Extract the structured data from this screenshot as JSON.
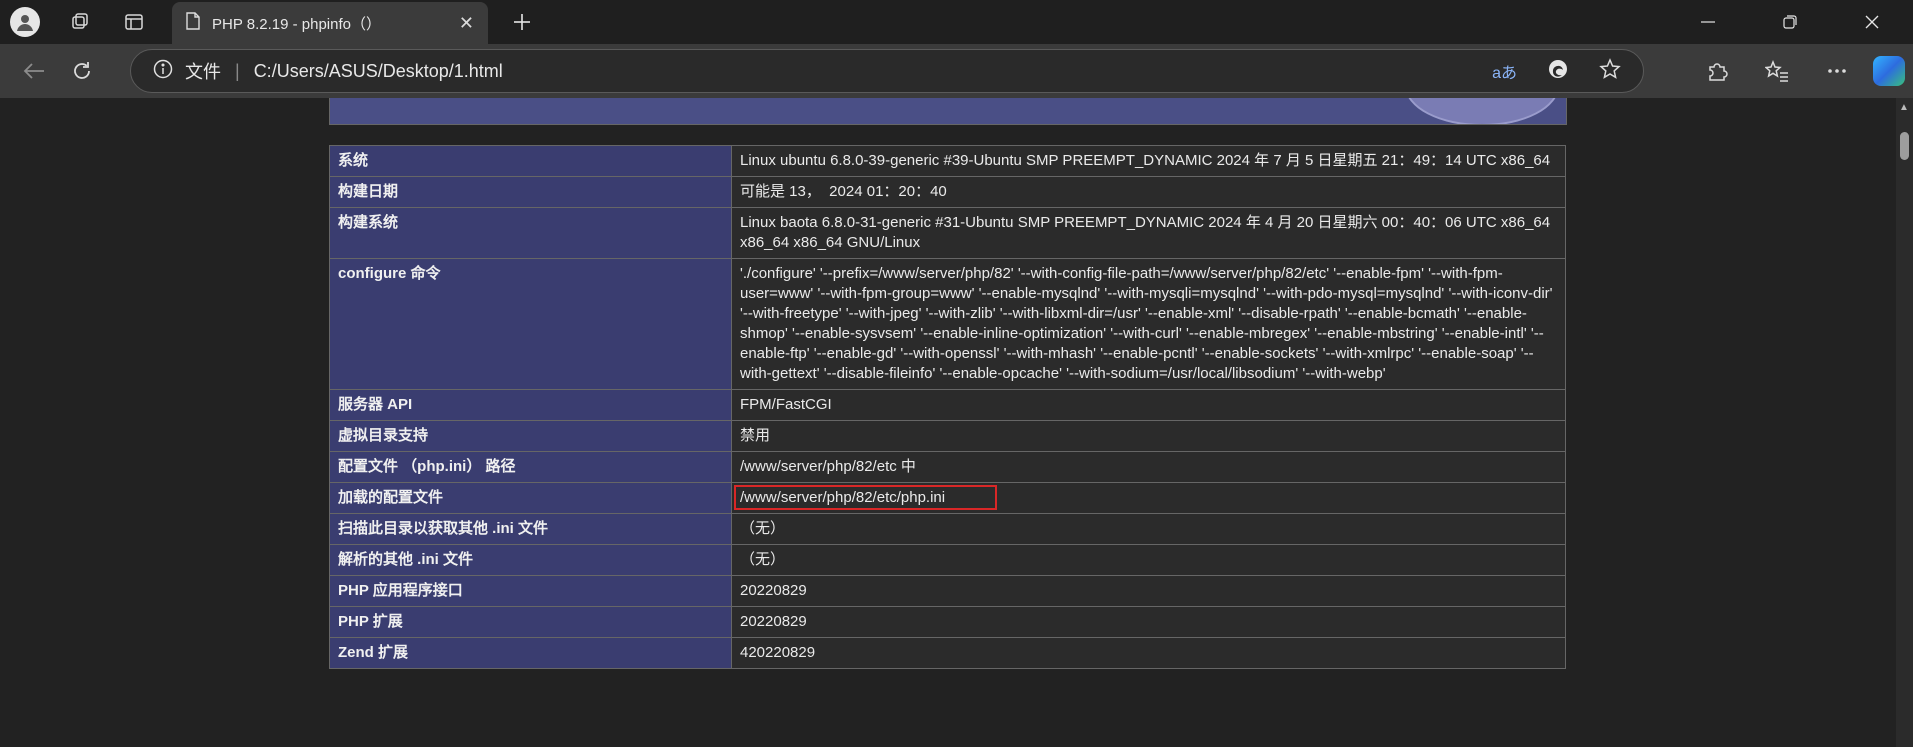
{
  "browser": {
    "tab": {
      "title": "PHP 8.2.19 - phpinfo（）"
    },
    "address_bar": {
      "site_label": "文件",
      "url": "C:/Users/ASUS/Desktop/1.html"
    },
    "icons": {
      "profile": "person-icon",
      "workspaces": "workspaces-icon",
      "vertical_tabs": "vertical-tabs-icon",
      "new_tab": "plus-icon",
      "back": "back-arrow-icon",
      "refresh": "refresh-icon",
      "info": "info-icon",
      "read_aloud": "read-aloud-icon",
      "edge_shield": "edge-icon",
      "favorite": "star-icon",
      "extensions": "puzzle-icon",
      "favorites_list": "favorites-icon",
      "more": "more-icon",
      "copilot": "copilot-icon"
    }
  },
  "phpinfo": {
    "rows": [
      {
        "key": "系统",
        "value": "Linux ubuntu 6.8.0-39-generic #39-Ubuntu SMP PREEMPT_DYNAMIC 2024 年 7 月 5 日星期五 21：49：14 UTC x86_64"
      },
      {
        "key": "构建日期",
        "value": "可能是 13，  2024 01：20：40"
      },
      {
        "key": "构建系统",
        "value": "Linux baota 6.8.0-31-generic #31-Ubuntu SMP PREEMPT_DYNAMIC 2024 年 4 月 20 日星期六 00：40：06 UTC x86_64 x86_64 x86_64 GNU/Linux"
      },
      {
        "key": "configure 命令",
        "value": "'./configure' '--prefix=/www/server/php/82' '--with-config-file-path=/www/server/php/82/etc' '--enable-fpm' '--with-fpm-user=www' '--with-fpm-group=www' '--enable-mysqlnd' '--with-mysqli=mysqlnd' '--with-pdo-mysql=mysqlnd' '--with-iconv-dir' '--with-freetype' '--with-jpeg' '--with-zlib' '--with-libxml-dir=/usr' '--enable-xml' '--disable-rpath' '--enable-bcmath' '--enable-shmop' '--enable-sysvsem' '--enable-inline-optimization' '--with-curl' '--enable-mbregex' '--enable-mbstring' '--enable-intl' '--enable-ftp' '--enable-gd' '--with-openssl' '--with-mhash' '--enable-pcntl' '--enable-sockets' '--with-xmlrpc' '--enable-soap' '--with-gettext' '--disable-fileinfo' '--enable-opcache' '--with-sodium=/usr/local/libsodium' '--with-webp'"
      },
      {
        "key": "服务器 API",
        "value": "FPM/FastCGI"
      },
      {
        "key": "虚拟目录支持",
        "value": "禁用"
      },
      {
        "key": "配置文件 （php.ini） 路径",
        "value": "/www/server/php/82/etc 中"
      },
      {
        "key": "加载的配置文件",
        "value": "/www/server/php/82/etc/php.ini"
      },
      {
        "key": "扫描此目录以获取其他 .ini 文件",
        "value": "（无）"
      },
      {
        "key": "解析的其他 .ini 文件",
        "value": "（无）"
      },
      {
        "key": "PHP 应用程序接口",
        "value": "20220829"
      },
      {
        "key": "PHP 扩展",
        "value": "20220829"
      },
      {
        "key": "Zend 扩展",
        "value": "420220829"
      }
    ]
  },
  "colors": {
    "key_cell_bg": "#3a3d70",
    "value_cell_bg": "#2b2b2b",
    "highlight_border": "#d92727"
  }
}
